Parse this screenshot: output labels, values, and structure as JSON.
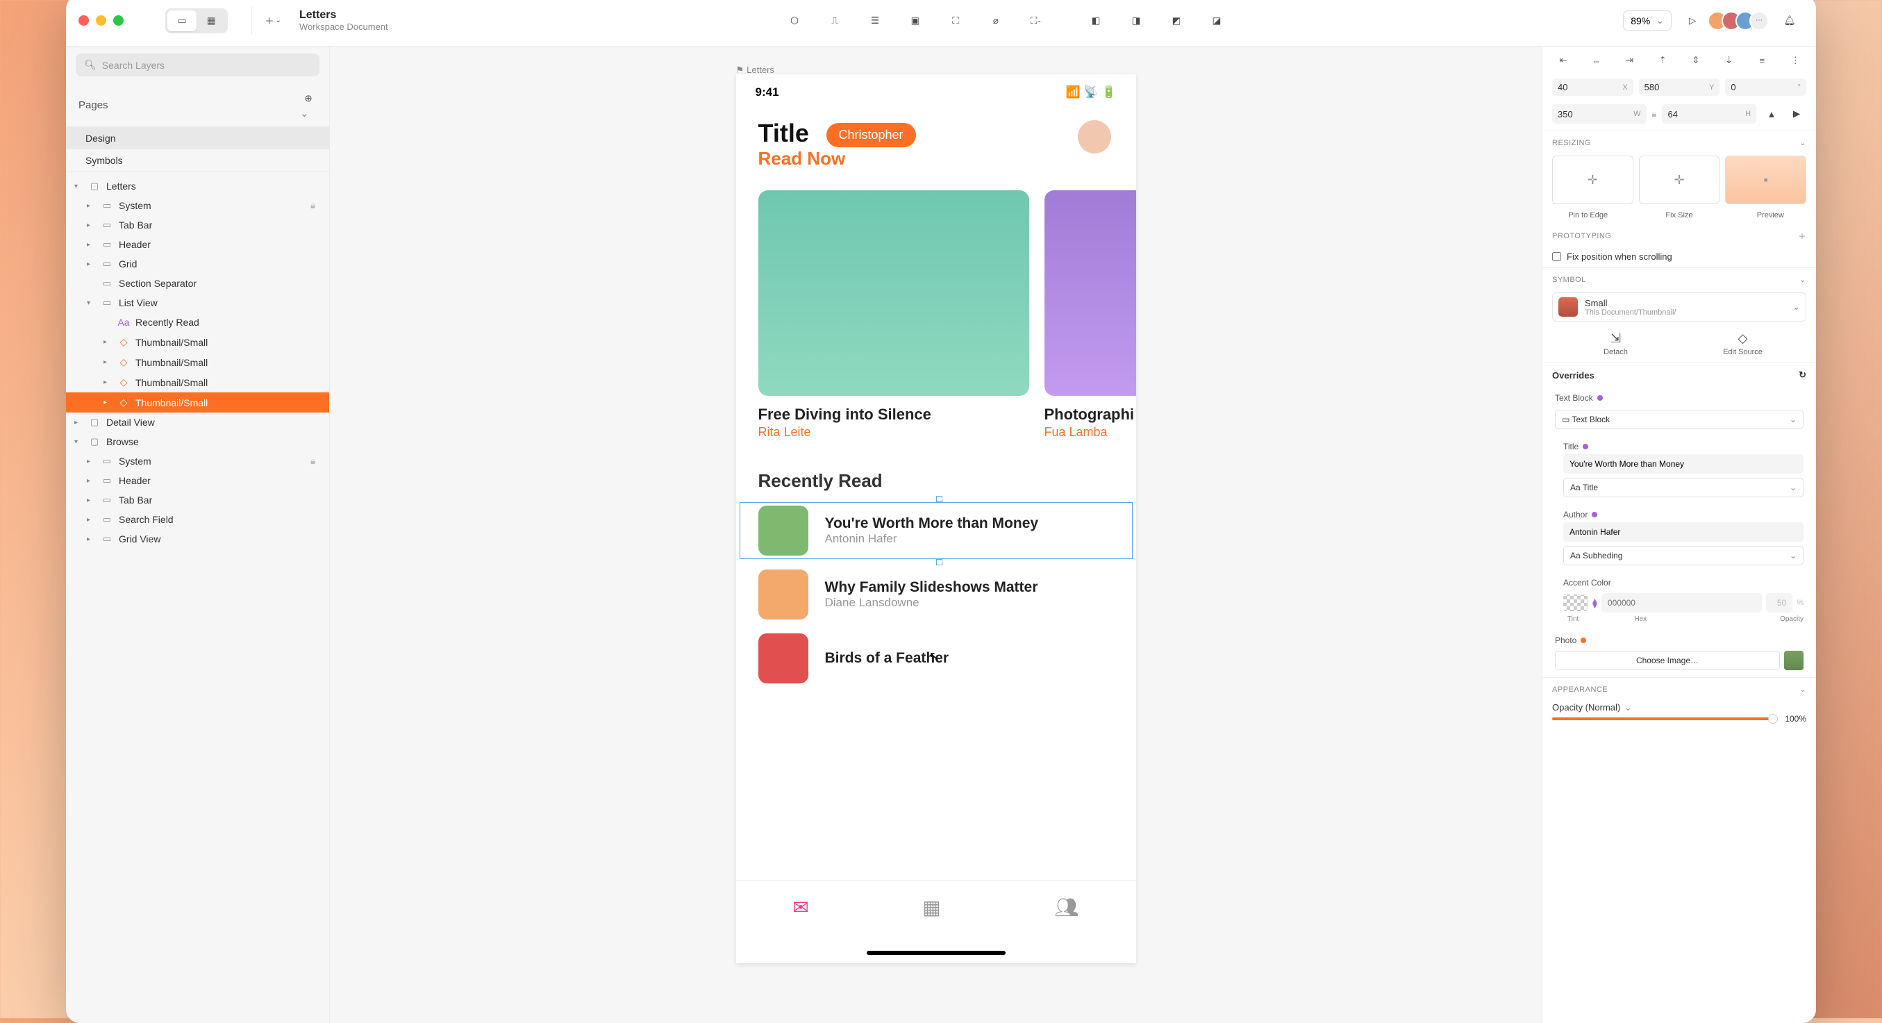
{
  "toolbar": {
    "doc_title": "Letters",
    "doc_subtitle": "Workspace Document",
    "zoom": "89%"
  },
  "sidebar": {
    "search_placeholder": "Search Layers",
    "pages_header": "Pages",
    "pages": [
      "Design",
      "Symbols"
    ],
    "artboard": "Letters",
    "layers_main": {
      "system": "System",
      "tabbar": "Tab Bar",
      "header": "Header",
      "grid": "Grid",
      "section_sep": "Section Separator",
      "list_view": "List View",
      "recently_read": "Recently Read",
      "thumb1": "Thumbnail/Small",
      "thumb2": "Thumbnail/Small",
      "thumb3": "Thumbnail/Small",
      "thumb4": "Thumbnail/Small",
      "detail_view": "Detail View"
    },
    "artboard2": "Browse",
    "layers_browse": {
      "system": "System",
      "header": "Header",
      "tabbar": "Tab Bar",
      "search": "Search Field",
      "grid_view": "Grid View"
    }
  },
  "canvas": {
    "artboard_label": "Letters",
    "status_time": "9:41",
    "title": "Title",
    "readnow": "Read Now",
    "badge": "Christopher",
    "cards": [
      {
        "title": "Free Diving into Silence",
        "author": "Rita Leite"
      },
      {
        "title": "Photographi",
        "author": "Fua Lamba"
      }
    ],
    "section": "Recently Read",
    "rows": [
      {
        "title": "You're Worth More than Money",
        "author": "Antonin Hafer"
      },
      {
        "title": "Why Family Slideshows Matter",
        "author": "Diane Lansdowne"
      },
      {
        "title": "Birds of a Feather",
        "author": ""
      }
    ]
  },
  "inspector": {
    "x": "40",
    "y": "580",
    "rot": "0",
    "w": "350",
    "h": "64",
    "resizing": "RESIZING",
    "resize_labels": [
      "Pin to Edge",
      "Fix Size",
      "Preview"
    ],
    "prototyping": "PROTOTYPING",
    "fix_scroll": "Fix position when scrolling",
    "symbol": "SYMBOL",
    "symbol_name": "Small",
    "symbol_path": "This Document/Thumbnail/",
    "detach": "Detach",
    "edit_source": "Edit Source",
    "overrides": "Overrides",
    "textblock": "Text Block",
    "textblock_select": "Text Block",
    "title_label": "Title",
    "title_value": "You're Worth More than Money",
    "title_style": "Aa Title",
    "author_label": "Author",
    "author_value": "Antonin Hafer",
    "author_style": "Aa Subheding",
    "accent_label": "Accent Color",
    "hex_placeholder": "000000",
    "opacity_val": "50",
    "opacity_pct": "%",
    "tint": "Tint",
    "hex": "Hex",
    "opacity": "Opacity",
    "photo": "Photo",
    "choose": "Choose Image…",
    "appearance": "APPEARANCE",
    "opacity_mode": "Opacity (Normal)",
    "opacity_full": "100%"
  }
}
